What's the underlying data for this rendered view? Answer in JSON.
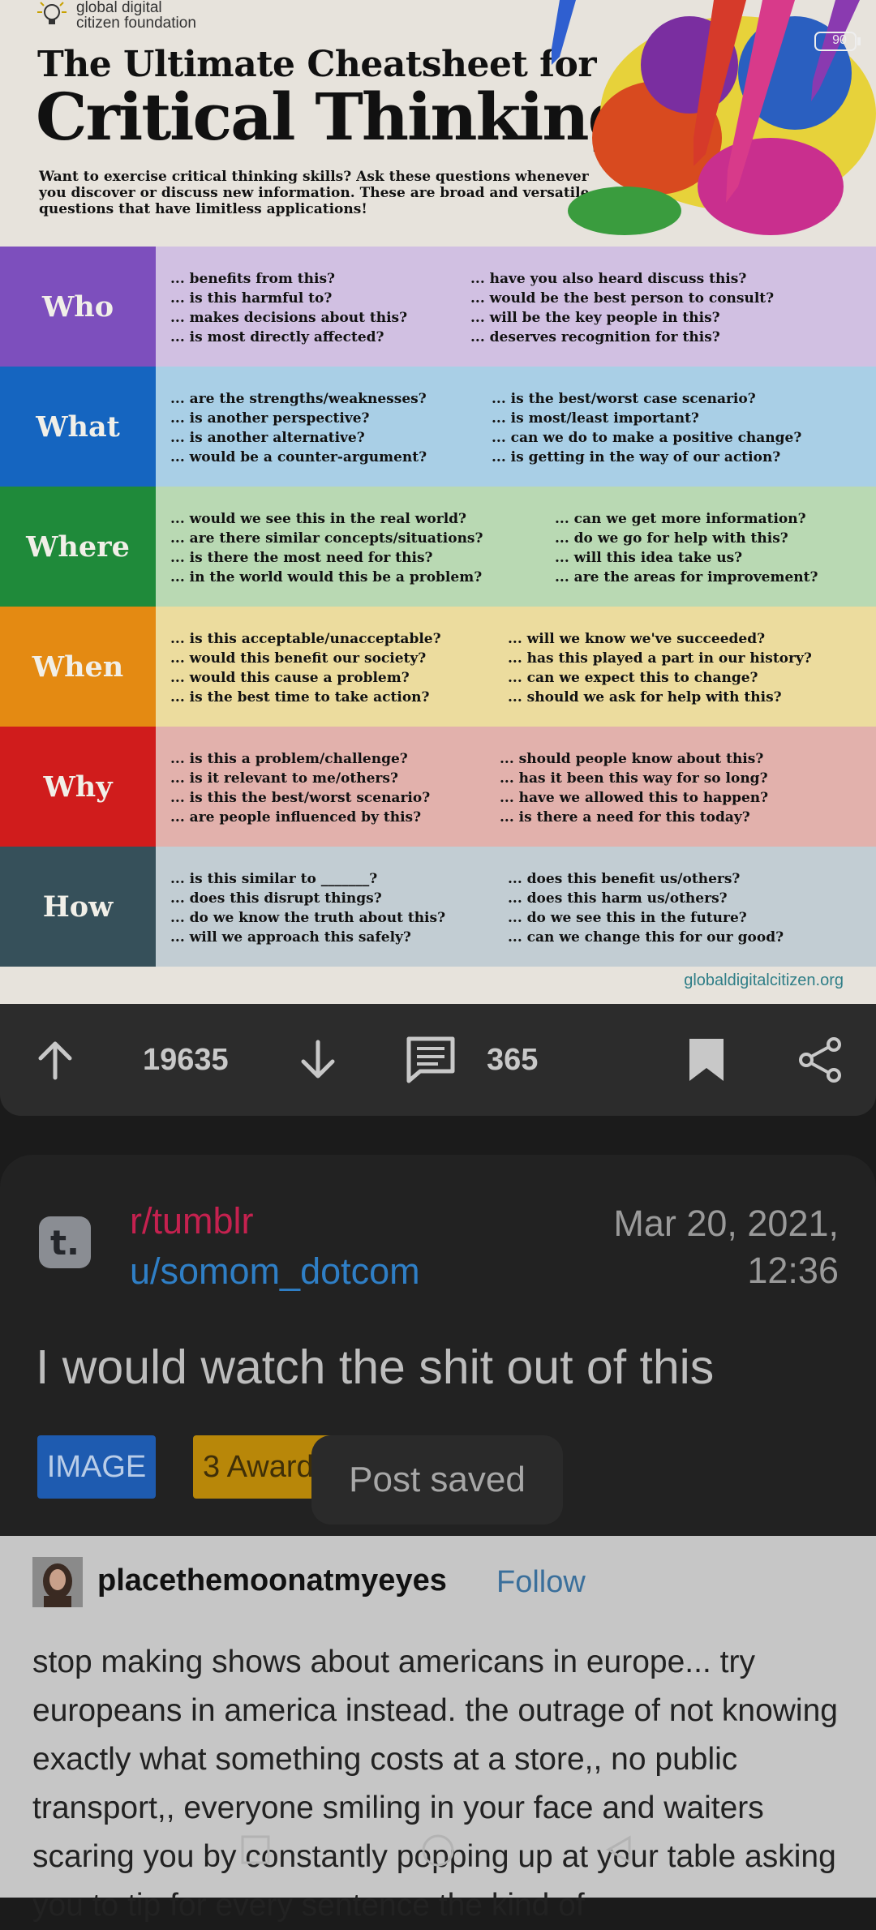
{
  "infographic": {
    "brand": "global digital\ncitizen foundation",
    "title_line1": "The Ultimate Cheatsheet for",
    "title_line2": "Critical Thinking",
    "intro": "Want to exercise critical thinking skills? Ask these questions whenever you discover or discuss new information. These are broad and versatile questions that have limitless applications!",
    "footer_url": "globaldigitalcitizen.org",
    "rows": [
      {
        "label": "Who",
        "color": "#7d4fbd",
        "bg": "#d1c0e2",
        "left": [
          "... benefits from this?",
          "... is this harmful to?",
          "... makes decisions about this?",
          "... is most directly affected?"
        ],
        "right": [
          "... have you also heard discuss this?",
          "... would be the best person to consult?",
          "... will be the key people in this?",
          "... deserves recognition for this?"
        ]
      },
      {
        "label": "What",
        "color": "#1565c0",
        "bg": "#a9cfe6",
        "left": [
          "... are the strengths/weaknesses?",
          "... is another perspective?",
          "... is another alternative?",
          "... would be a counter-argument?"
        ],
        "right": [
          "... is the best/worst case scenario?",
          "... is most/least important?",
          "... can we do to make a positive change?",
          "... is getting in the way of our action?"
        ]
      },
      {
        "label": "Where",
        "color": "#1f8a3a",
        "bg": "#b9d9b3",
        "left": [
          "... would we see this in the real world?",
          "... are there similar concepts/situations?",
          "... is there the most need for this?",
          "... in the world would this be a problem?"
        ],
        "right": [
          "... can we get more information?",
          "... do we go for help with this?",
          "... will this idea take us?",
          "... are the areas for improvement?"
        ]
      },
      {
        "label": "When",
        "color": "#e48a12",
        "bg": "#ecdc9e",
        "left": [
          "... is this acceptable/unacceptable?",
          "... would this benefit our society?",
          "... would this cause a problem?",
          "... is the best time to take action?"
        ],
        "right": [
          "... will we know we've succeeded?",
          "... has this played a part in our history?",
          "... can we expect this to change?",
          "... should we ask for help with this?"
        ]
      },
      {
        "label": "Why",
        "color": "#d01c1c",
        "bg": "#e2b1ac",
        "left": [
          "... is this a problem/challenge?",
          "... is it relevant to me/others?",
          "... is this the best/worst scenario?",
          "... are people influenced by this?"
        ],
        "right": [
          "... should people know about this?",
          "... has it been this way for so long?",
          "... have we allowed this to happen?",
          "... is there a need for this today?"
        ]
      },
      {
        "label": "How",
        "color": "#36505a",
        "bg": "#c2cdd3",
        "left": [
          "... is this similar to _______?",
          "... does this disrupt things?",
          "... do we know the truth about this?",
          "... will we approach this safely?"
        ],
        "right": [
          "... does this benefit us/others?",
          "... does this harm us/others?",
          "... do we see this in the future?",
          "... can we change this for our good?"
        ]
      }
    ]
  },
  "status": {
    "battery": "90"
  },
  "actions": {
    "upvotes": "19635",
    "comments": "365"
  },
  "post": {
    "subreddit": "r/tumblr",
    "username": "u/somom_dotcom",
    "date": "Mar 20, 2021,\n12:36",
    "title": "I would watch the shit out of this",
    "flair_image": "IMAGE",
    "flair_awards": "3 Awards",
    "logo_letter": "t."
  },
  "toast": "Post saved",
  "comment": {
    "user": "placethemoonatmyeyes",
    "follow": "Follow",
    "text": "stop making shows about americans in europe... try europeans in america instead. the outrage of not knowing exactly what something costs at a store,, no public transport,, everyone smiling in your face and waiters scaring you by constantly popping up at your table asking you to tip for every sentence the kind of"
  }
}
